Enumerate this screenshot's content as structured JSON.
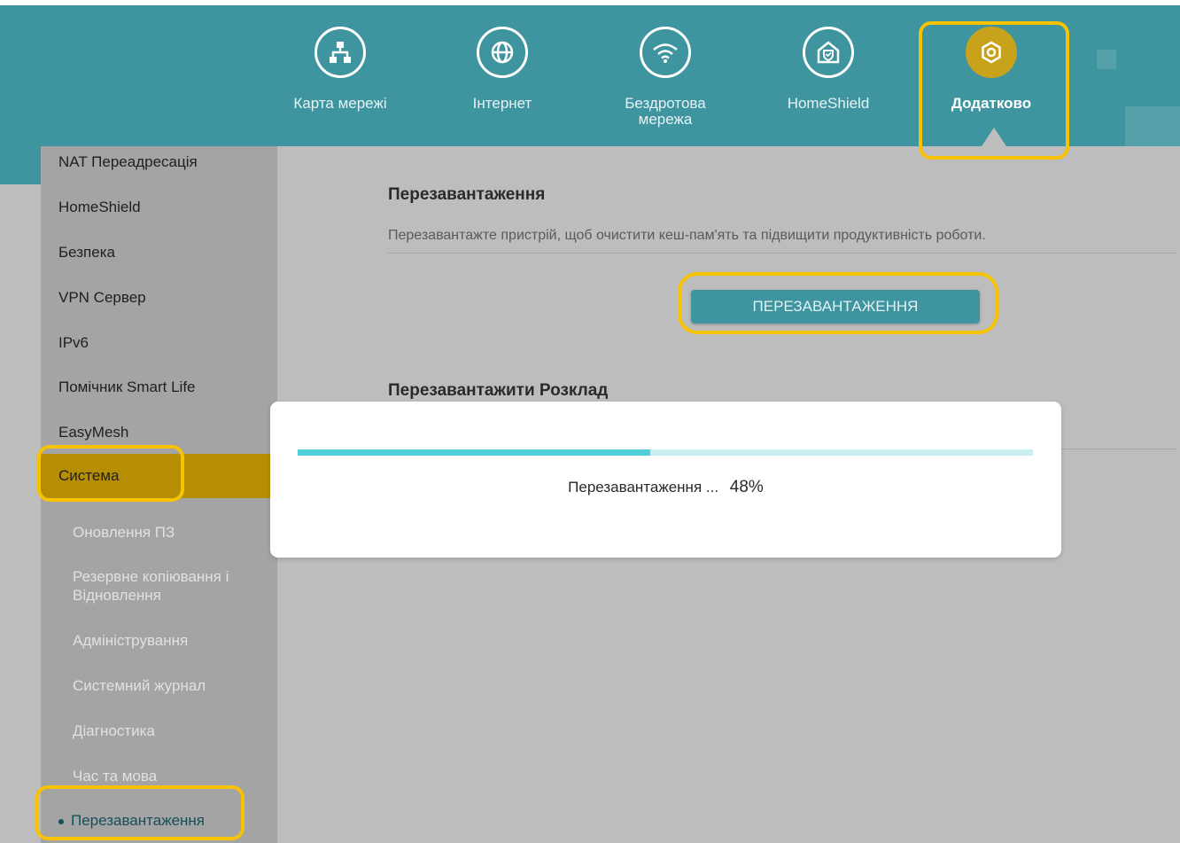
{
  "nav": {
    "items": [
      {
        "label": "Карта мережі",
        "icon": "network-map-icon"
      },
      {
        "label": "Інтернет",
        "icon": "globe-icon"
      },
      {
        "label": "Бездротова мережа",
        "icon": "wifi-icon"
      },
      {
        "label": "HomeShield",
        "icon": "home-shield-icon"
      },
      {
        "label": "Додатково",
        "icon": "gear-icon"
      }
    ],
    "active_index": 4
  },
  "sidebar": {
    "items": [
      "NAT Переадресація",
      "HomeShield",
      "Безпека",
      "VPN Сервер",
      "IPv6",
      "Помічник Smart Life",
      "EasyMesh",
      "Система"
    ],
    "active_item": "Система",
    "sub_items": [
      "Оновлення ПЗ",
      "Резервне копіювання і Відновлення",
      "Адміністрування",
      "Системний журнал",
      "Діагностика",
      "Час та мова",
      "Перезавантаження"
    ],
    "current_sub_item": "Перезавантаження"
  },
  "content": {
    "reboot": {
      "title": "Перезавантаження",
      "description": "Перезавантажте пристрій, щоб очистити кеш-пам'ять та підвищити продуктивність роботи.",
      "button_label": "ПЕРЕЗАВАНТАЖЕННЯ"
    },
    "schedule": {
      "title": "Перезавантажити Розклад"
    }
  },
  "modal": {
    "status_text": "Перезавантаження ...",
    "progress_label": "48%",
    "progress_fraction": 0.48
  },
  "colors": {
    "header": "#3e949f",
    "accent_gold": "#c9a21c",
    "highlight": "#f7c200",
    "progress_fill": "#4fcfd8",
    "progress_track": "#c8eef2"
  }
}
